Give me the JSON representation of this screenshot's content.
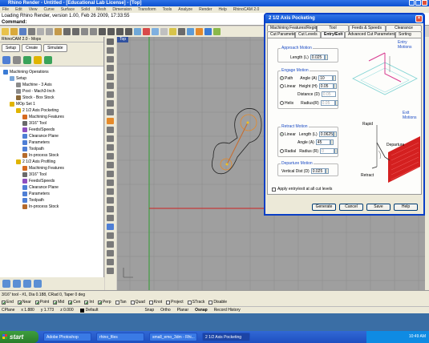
{
  "app": {
    "title": "Rhino Render - Untitled - [Educational Lab License] - [Top]",
    "menu": [
      "File",
      "Edit",
      "View",
      "Curve",
      "Surface",
      "Solid",
      "Mesh",
      "Dimension",
      "Transform",
      "Tools",
      "Analyze",
      "Render",
      "Help",
      "RhinoCAM 2.0"
    ],
    "command_history": "Loading Rhino Render, version 1.00, Feb 26 2009, 17:33:55",
    "command_prompt": "Command:"
  },
  "left_panel": {
    "header": "RhinoCAM 2.0 - Mops",
    "tabs": [
      "Setup",
      "Create",
      "Simulate"
    ],
    "tree": [
      {
        "label": "Machining Operations",
        "depth": 0,
        "color": "#3a7bd5"
      },
      {
        "label": "Setup",
        "depth": 1,
        "color": "#7aa6d8"
      },
      {
        "label": "Machine - 3 Axis",
        "depth": 2,
        "color": "#8b8b8b"
      },
      {
        "label": "Post - Mach3-Inch",
        "depth": 2,
        "color": "#8b8b8b"
      },
      {
        "label": "Stock - Box Stock",
        "depth": 2,
        "color": "#8b6a3a"
      },
      {
        "label": "MOp Set 1",
        "depth": 1,
        "color": "#e0b400"
      },
      {
        "label": "2 1/2 Axis Pocketing",
        "depth": 2,
        "color": "#e0b400"
      },
      {
        "label": "Machining Features",
        "depth": 3,
        "color": "#d66a1f"
      },
      {
        "label": "3/16\" Tool",
        "depth": 3,
        "color": "#6a6a6a"
      },
      {
        "label": "Feeds/Speeds",
        "depth": 3,
        "color": "#8f4fbf"
      },
      {
        "label": "Clearance Plane",
        "depth": 3,
        "color": "#4f7fd5"
      },
      {
        "label": "Parameters",
        "depth": 3,
        "color": "#4f7fd5"
      },
      {
        "label": "Toolpath",
        "depth": 3,
        "color": "#4f7fd5"
      },
      {
        "label": "In-process Stock",
        "depth": 3,
        "color": "#b56a2b"
      },
      {
        "label": "2 1/2 Axis Profiling",
        "depth": 2,
        "color": "#e0b400"
      },
      {
        "label": "Machining Features",
        "depth": 3,
        "color": "#d66a1f"
      },
      {
        "label": "3/16\" Tool",
        "depth": 3,
        "color": "#6a6a6a"
      },
      {
        "label": "Feeds/Speeds",
        "depth": 3,
        "color": "#8f4fbf"
      },
      {
        "label": "Clearance Plane",
        "depth": 3,
        "color": "#4f7fd5"
      },
      {
        "label": "Parameters",
        "depth": 3,
        "color": "#4f7fd5"
      },
      {
        "label": "Toolpath",
        "depth": 3,
        "color": "#4f7fd5"
      },
      {
        "label": "In-process Stock",
        "depth": 3,
        "color": "#b56a2b"
      }
    ]
  },
  "viewport": {
    "label": "Top"
  },
  "status": {
    "tool_info": "3/16\" tool - #1, Dia 0.188, CRad 0, Taper 0 deg",
    "snaps": [
      {
        "label": "End",
        "on": true
      },
      {
        "label": "Near",
        "on": true
      },
      {
        "label": "Point",
        "on": true
      },
      {
        "label": "Mid",
        "on": true
      },
      {
        "label": "Cen",
        "on": true
      },
      {
        "label": "Int",
        "on": true
      },
      {
        "label": "Perp",
        "on": true
      },
      {
        "label": "Tan",
        "on": false
      },
      {
        "label": "Quad",
        "on": false
      },
      {
        "label": "Knot",
        "on": false
      },
      {
        "label": "Project",
        "on": false
      },
      {
        "label": "STrack",
        "on": false
      },
      {
        "label": "Disable",
        "on": false
      }
    ],
    "cplane": "CPlane",
    "x": "x 1.880",
    "y": "y 1.773",
    "z": "z 0.000",
    "layer": "Default",
    "toggles": [
      "Snap",
      "Ortho",
      "Planar",
      "Osnap",
      "Record History"
    ]
  },
  "taskbar": {
    "start": "start",
    "tasks": [
      "Adobe Photoshop",
      "rhino_files",
      "small_emo_3dm - Rhi...",
      "2 1/2 Axis Pocketing"
    ],
    "time": "10:49 AM"
  },
  "dialog": {
    "title": "2 1/2 Axis Pocketing",
    "tabs_row1": [
      "Machining Features/Regions",
      "Tool",
      "Feeds & Speeds",
      "Clearance"
    ],
    "tabs_row2": [
      "Cut Parameters",
      "Cut Levels",
      "Entry/Exit",
      "Advanced Cut Parameters",
      "Sorting"
    ],
    "active_tab": "Entry/Exit",
    "entry_motions_label": "Entry Motions",
    "exit_motions_label": "Exit Motions",
    "approach": {
      "title": "Approach Motion",
      "length_label": "Length (L)",
      "length": "0.025"
    },
    "engage": {
      "title": "Engage Motion",
      "path_label": "Path",
      "angle_label": "Angle (A)",
      "angle": "10",
      "linear_label": "Linear",
      "height_label": "Height (H)",
      "height": "0.05",
      "distance_label": "Distance (D)",
      "distance": "0.05",
      "helix_label": "Helix",
      "radius_label": "Radius(R)",
      "radius": "0.05"
    },
    "retract": {
      "title": "Retract Motion",
      "linear_label": "Linear",
      "length_label": "Length (L)",
      "length": "0.0625",
      "angle_label": "Angle (A)",
      "angle": "45",
      "radial_label": "Radial",
      "radius_label": "Radius (R)",
      "radius": "0"
    },
    "departure": {
      "title": "Departure Motion",
      "vdist_label": "Vertical Dist (D)",
      "vdist": "0.025"
    },
    "diagram_labels": {
      "rapid": "Rapid",
      "departure": "Departure",
      "retract": "Retract"
    },
    "apply_all": "Apply entry/exit at all cut levels",
    "buttons": [
      "Generate",
      "Cancel",
      "Save",
      "Help"
    ]
  }
}
